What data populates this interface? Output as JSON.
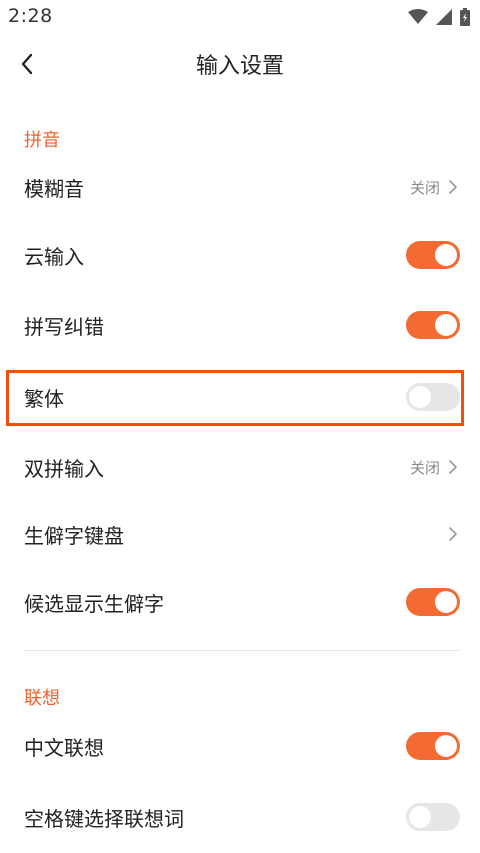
{
  "status_bar": {
    "time": "2:28",
    "icons": [
      "wifi-icon",
      "signal-icon",
      "battery-icon"
    ]
  },
  "header": {
    "title": "输入设置",
    "back_icon": "back-icon"
  },
  "sections": {
    "pinyin": {
      "title": "拼音",
      "items": {
        "fuzzy": {
          "label": "模糊音",
          "value": "关闭"
        },
        "cloud": {
          "label": "云输入",
          "toggle": "on"
        },
        "spell_correction": {
          "label": "拼写纠错",
          "toggle": "on"
        },
        "traditional": {
          "label": "繁体",
          "toggle": "off"
        },
        "double_pinyin": {
          "label": "双拼输入",
          "value": "关闭"
        },
        "rare_keyboard": {
          "label": "生僻字键盘"
        },
        "show_rare": {
          "label": "候选显示生僻字",
          "toggle": "on"
        }
      }
    },
    "association": {
      "title": "联想",
      "items": {
        "chinese": {
          "label": "中文联想",
          "toggle": "on"
        },
        "space_select": {
          "label": "空格键选择联想词",
          "toggle": "off"
        }
      }
    }
  },
  "colors": {
    "accent": "#f36b32",
    "highlight_border": "#f24e0c",
    "toggle_off": "#e6e6e6"
  }
}
